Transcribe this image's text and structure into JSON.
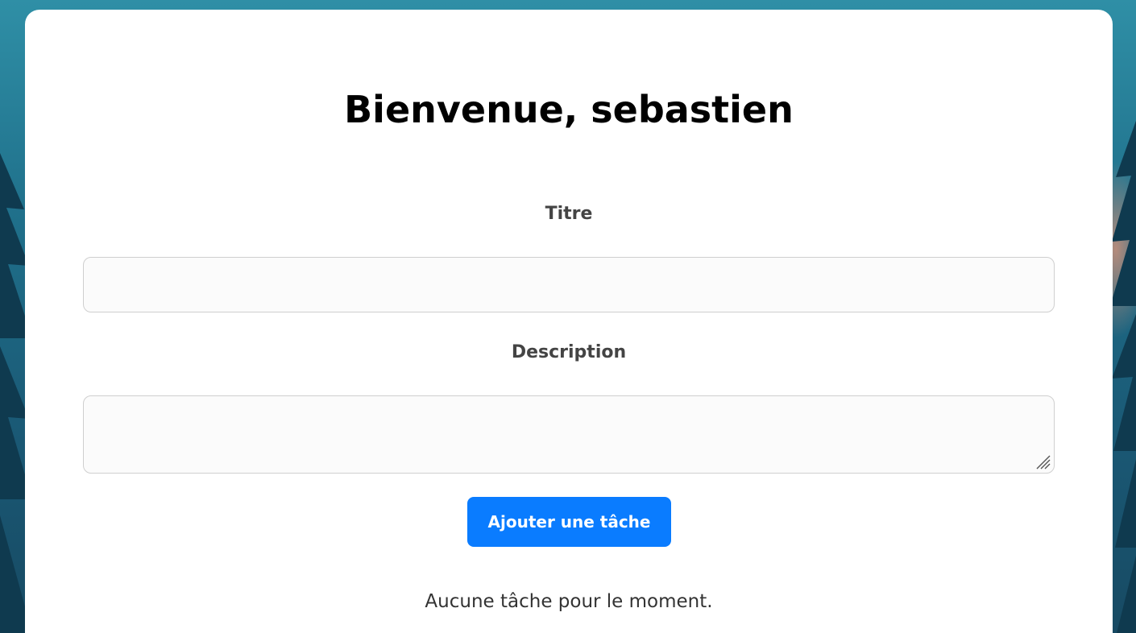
{
  "page": {
    "greeting": "Bienvenue, sebastien",
    "background_colors": [
      "#2f8fa6",
      "#1a5874",
      "#174a63"
    ]
  },
  "form": {
    "title_label": "Titre",
    "title_value": "",
    "description_label": "Description",
    "description_value": "",
    "submit_label": "Ajouter une tâche",
    "submit_color": "#0a7cff"
  },
  "tasks": {
    "items": [],
    "empty_message": "Aucune tâche pour le moment."
  }
}
